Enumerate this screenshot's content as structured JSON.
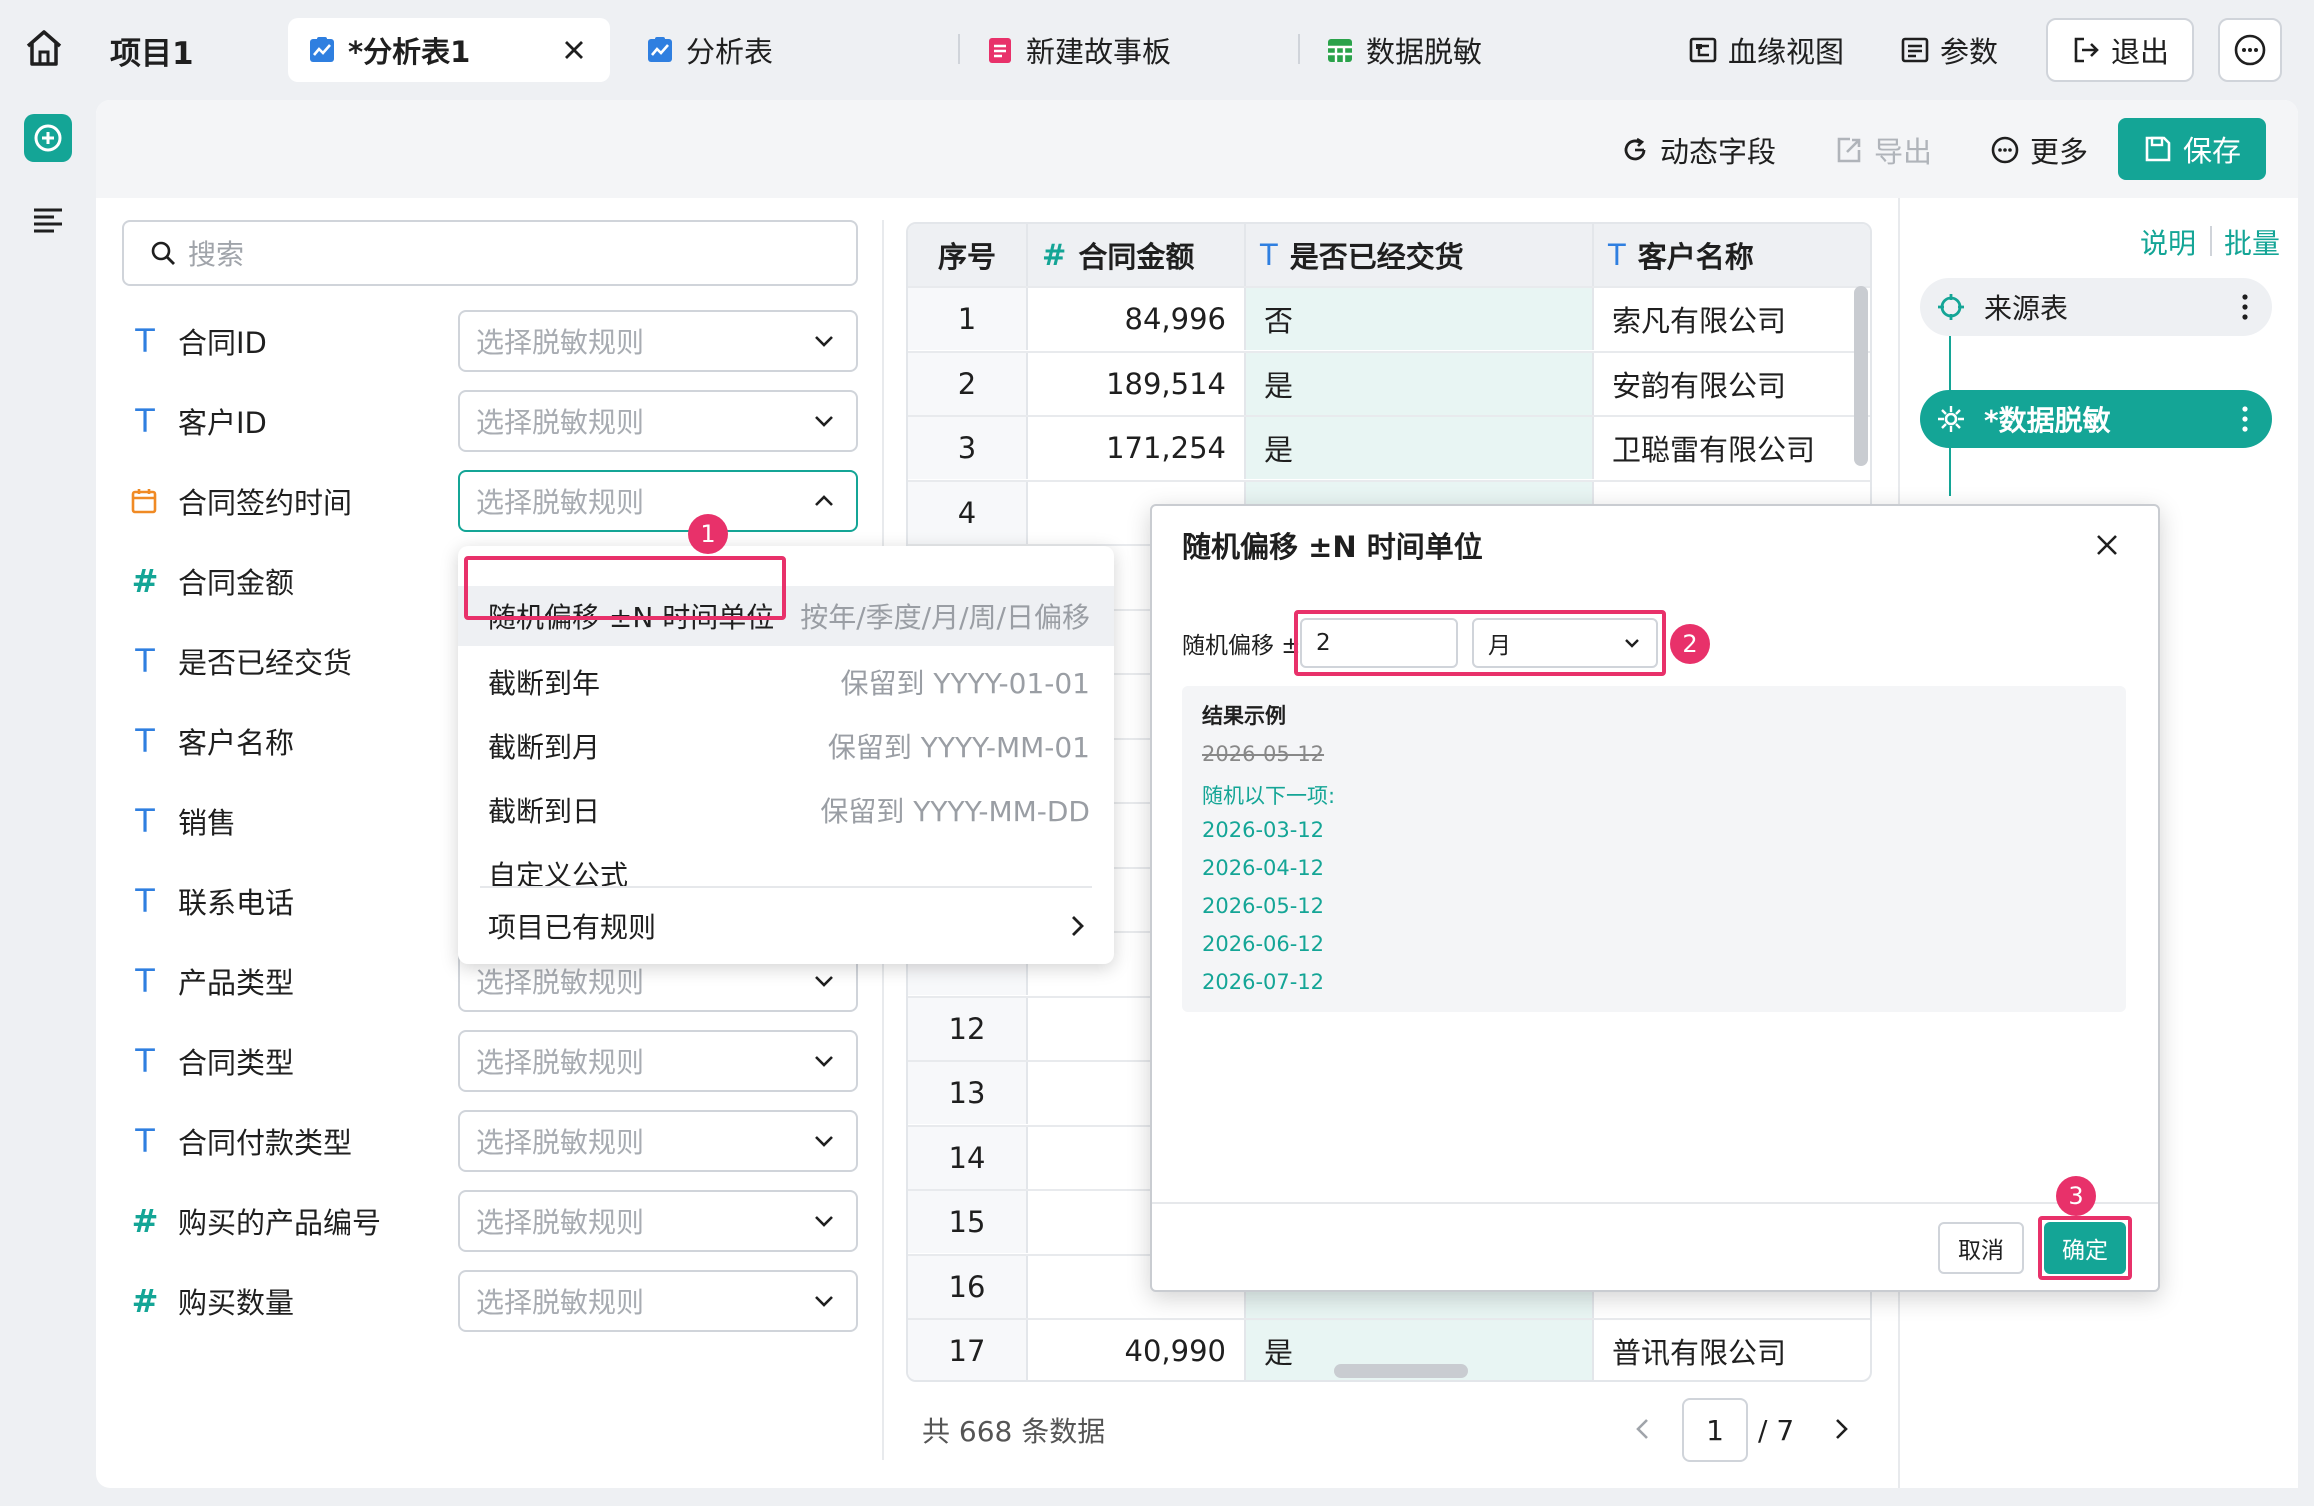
{
  "header": {
    "project_title": "项目1",
    "tabs": [
      {
        "label": "*分析表1",
        "active": true
      },
      {
        "label": "分析表",
        "active": false
      },
      {
        "label": "新建故事板",
        "active": false
      },
      {
        "label": "数据脱敏",
        "active": false
      }
    ],
    "lineage_label": "血缘视图",
    "params_label": "参数",
    "exit_label": "退出"
  },
  "toolbar": {
    "dynamic_field_label": "动态字段",
    "export_label": "导出",
    "more_label": "更多",
    "save_label": "保存"
  },
  "fields": {
    "search_placeholder": "搜索",
    "select_placeholder": "选择脱敏规则",
    "items": [
      {
        "type": "T",
        "name": "合同ID"
      },
      {
        "type": "T",
        "name": "客户ID"
      },
      {
        "type": "date",
        "name": "合同签约时间"
      },
      {
        "type": "#",
        "name": "合同金额"
      },
      {
        "type": "T",
        "name": "是否已经交货"
      },
      {
        "type": "T",
        "name": "客户名称"
      },
      {
        "type": "T",
        "name": "销售"
      },
      {
        "type": "T",
        "name": "联系电话"
      },
      {
        "type": "T",
        "name": "产品类型"
      },
      {
        "type": "T",
        "name": "合同类型"
      },
      {
        "type": "T",
        "name": "合同付款类型"
      },
      {
        "type": "#",
        "name": "购买的产品编号"
      },
      {
        "type": "#",
        "name": "购买数量"
      }
    ]
  },
  "dropdown": {
    "items": [
      {
        "label": "随机偏移 ±N 时间单位",
        "hint": "按年/季度/月/周/日偏移"
      },
      {
        "label": "截断到年",
        "hint": "保留到 YYYY-01-01"
      },
      {
        "label": "截断到月",
        "hint": "保留到 YYYY-MM-01"
      },
      {
        "label": "截断到日",
        "hint": "保留到 YYYY-MM-DD"
      },
      {
        "label": "自定义公式",
        "hint": ""
      }
    ],
    "existing_rules_label": "项目已有规则"
  },
  "table": {
    "headers": {
      "index": "序号",
      "amount": "合同金额",
      "delivered": "是否已经交货",
      "customer": "客户名称"
    },
    "type_text": "T",
    "type_num": "#",
    "rows": [
      {
        "index": "1",
        "amount": "84,996",
        "delivered": "否",
        "customer": "索凡有限公司"
      },
      {
        "index": "2",
        "amount": "189,514",
        "delivered": "是",
        "customer": "安韵有限公司"
      },
      {
        "index": "3",
        "amount": "171,254",
        "delivered": "是",
        "customer": "卫聪雷有限公司"
      },
      {
        "index": "4",
        "amount": "",
        "delivered": "",
        "customer": ""
      },
      {
        "index": "",
        "amount": "",
        "delivered": "",
        "customer": ""
      },
      {
        "index": "",
        "amount": "",
        "delivered": "",
        "customer": ""
      },
      {
        "index": "",
        "amount": "",
        "delivered": "",
        "customer": ""
      },
      {
        "index": "",
        "amount": "",
        "delivered": "",
        "customer": ""
      },
      {
        "index": "",
        "amount": "",
        "delivered": "",
        "customer": ""
      },
      {
        "index": "",
        "amount": "",
        "delivered": "",
        "customer": ""
      },
      {
        "index": "",
        "amount": "",
        "delivered": "",
        "customer": ""
      },
      {
        "index": "12",
        "amount": "",
        "delivered": "",
        "customer": ""
      },
      {
        "index": "13",
        "amount": "",
        "delivered": "",
        "customer": ""
      },
      {
        "index": "14",
        "amount": "",
        "delivered": "",
        "customer": ""
      },
      {
        "index": "15",
        "amount": "",
        "delivered": "",
        "customer": ""
      },
      {
        "index": "16",
        "amount": "",
        "delivered": "",
        "customer": ""
      },
      {
        "index": "17",
        "amount": "40,990",
        "delivered": "是",
        "customer": "普讯有限公司"
      }
    ],
    "total_label": "共 668 条数据",
    "page_current": "1",
    "page_total": "/ 7"
  },
  "right_panel": {
    "explain_label": "说明",
    "batch_label": "批量",
    "node_source": "来源表",
    "node_mask": "*数据脱敏"
  },
  "modal": {
    "title": "随机偏移 ±N 时间单位",
    "offset_label": "随机偏移 ±",
    "offset_value": "2",
    "unit_value": "月",
    "example_title": "结果示例",
    "example_original": "2026-05-12",
    "example_random_label": "随机以下一项:",
    "example_dates": [
      "2026-03-12",
      "2026-04-12",
      "2026-05-12",
      "2026-06-12",
      "2026-07-12"
    ],
    "cancel_label": "取消",
    "ok_label": "确定"
  },
  "annotations": [
    "1",
    "2",
    "3"
  ],
  "colors": {
    "accent": "#14a596",
    "highlight": "#e8316a"
  }
}
